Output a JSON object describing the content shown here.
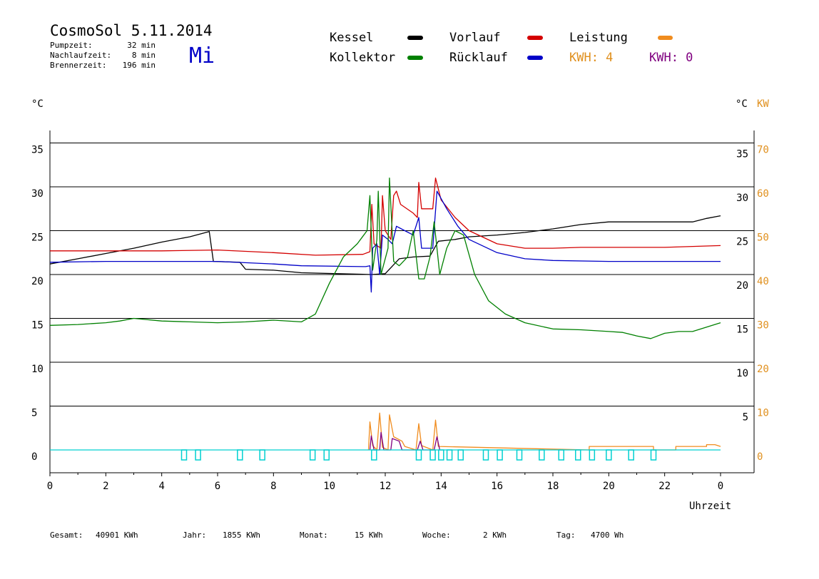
{
  "header": {
    "title": "CosmoSol 5.11.2014",
    "day": "Mi",
    "stats": [
      {
        "label": "Pumpzeit:",
        "value": "32 min"
      },
      {
        "label": "Nachlaufzeit:",
        "value": "8 min"
      },
      {
        "label": "Brennerzeit:",
        "value": "196 min"
      }
    ]
  },
  "legend": {
    "kessel": "Kessel",
    "kollektor": "Kollektor",
    "vorlauf": "Vorlauf",
    "ruecklauf": "Rücklauf",
    "leistung": "Leistung",
    "kwh1": "KWH: 4",
    "kwh2": "KWH: 0"
  },
  "axes": {
    "left_unit": "°C",
    "right_unit": "°C",
    "right_unit2": "KW",
    "xlabel": "Uhrzeit"
  },
  "footer": {
    "gesamt_label": "Gesamt:",
    "gesamt_value": "40901 KWh",
    "jahr_label": "Jahr:",
    "jahr_value": "1855 KWh",
    "monat_label": "Monat:",
    "monat_value": "15 KWh",
    "woche_label": "Woche:",
    "woche_value": "2 KWh",
    "tag_label": "Tag:",
    "tag_value": "4700 Wh"
  },
  "colors": {
    "kessel": "#000000",
    "kollektor": "#008000",
    "vorlauf": "#d40000",
    "ruecklauf": "#0000c8",
    "leistung": "#f08c1e",
    "kwh2": "#800080",
    "pump": "#00d0d0",
    "kwaxis": "#e0901e"
  },
  "chart_data": {
    "type": "line",
    "xlabel": "Uhrzeit",
    "x_ticks": [
      "0",
      "2",
      "4",
      "6",
      "8",
      "10",
      "12",
      "14",
      "16",
      "18",
      "20",
      "22",
      "0"
    ],
    "x_range": [
      0,
      24
    ],
    "y_left_ticks": [
      0,
      5,
      10,
      15,
      20,
      25,
      30,
      35
    ],
    "y_right_ticks": [
      5,
      10,
      15,
      20,
      25,
      30,
      35
    ],
    "y_kw_ticks": [
      0,
      10,
      20,
      30,
      40,
      50,
      60,
      70
    ],
    "ylim": [
      -2.5,
      38
    ],
    "grid": true,
    "series": [
      {
        "name": "Kessel",
        "key": "kessel",
        "points": [
          [
            0,
            21.2
          ],
          [
            1,
            21.8
          ],
          [
            2,
            22.4
          ],
          [
            3,
            23.0
          ],
          [
            4,
            23.7
          ],
          [
            5,
            24.3
          ],
          [
            5.7,
            24.9
          ],
          [
            5.85,
            21.5
          ],
          [
            6.8,
            21.4
          ],
          [
            7.0,
            20.6
          ],
          [
            8,
            20.5
          ],
          [
            9,
            20.2
          ],
          [
            11.5,
            20.0
          ],
          [
            12.0,
            20.1
          ],
          [
            12.5,
            21.8
          ],
          [
            13.0,
            22.0
          ],
          [
            13.6,
            22.1
          ],
          [
            13.9,
            23.8
          ],
          [
            14.5,
            24.0
          ],
          [
            15,
            24.3
          ],
          [
            16,
            24.5
          ],
          [
            17,
            24.8
          ],
          [
            18,
            25.2
          ],
          [
            19,
            25.7
          ],
          [
            20,
            26.0
          ],
          [
            21,
            26.0
          ],
          [
            22,
            26.0
          ],
          [
            23,
            26.0
          ],
          [
            23.5,
            26.4
          ],
          [
            24,
            26.7
          ]
        ]
      },
      {
        "name": "Vorlauf",
        "key": "vorlauf",
        "points": [
          [
            0,
            22.7
          ],
          [
            2,
            22.7
          ],
          [
            4,
            22.7
          ],
          [
            6,
            22.8
          ],
          [
            8,
            22.5
          ],
          [
            9.5,
            22.2
          ],
          [
            11.2,
            22.3
          ],
          [
            11.45,
            22.6
          ],
          [
            11.52,
            28.0
          ],
          [
            11.6,
            23.5
          ],
          [
            11.85,
            23.0
          ],
          [
            11.9,
            29.0
          ],
          [
            12.0,
            25.0
          ],
          [
            12.2,
            24.0
          ],
          [
            12.3,
            29.0
          ],
          [
            12.4,
            29.5
          ],
          [
            12.55,
            28.0
          ],
          [
            13.0,
            27.0
          ],
          [
            13.15,
            26.5
          ],
          [
            13.2,
            30.5
          ],
          [
            13.3,
            27.5
          ],
          [
            13.7,
            27.5
          ],
          [
            13.8,
            31.0
          ],
          [
            14.0,
            28.5
          ],
          [
            14.5,
            26.5
          ],
          [
            15,
            25.0
          ],
          [
            16,
            23.5
          ],
          [
            17,
            23.0
          ],
          [
            18,
            23.0
          ],
          [
            19,
            23.1
          ],
          [
            20,
            23.1
          ],
          [
            21,
            23.1
          ],
          [
            22,
            23.1
          ],
          [
            23,
            23.2
          ],
          [
            24,
            23.3
          ]
        ]
      },
      {
        "name": "Rücklauf",
        "key": "ruecklauf",
        "points": [
          [
            0,
            21.4
          ],
          [
            2,
            21.5
          ],
          [
            4,
            21.5
          ],
          [
            6,
            21.5
          ],
          [
            8,
            21.2
          ],
          [
            9,
            21.0
          ],
          [
            11.3,
            20.9
          ],
          [
            11.45,
            21.0
          ],
          [
            11.5,
            18.0
          ],
          [
            11.55,
            23.0
          ],
          [
            11.7,
            23.5
          ],
          [
            11.8,
            20.0
          ],
          [
            11.9,
            24.5
          ],
          [
            12.1,
            24.0
          ],
          [
            12.25,
            23.5
          ],
          [
            12.4,
            25.5
          ],
          [
            12.7,
            25.0
          ],
          [
            13.0,
            24.5
          ],
          [
            13.2,
            26.5
          ],
          [
            13.3,
            23.0
          ],
          [
            13.7,
            23.0
          ],
          [
            13.85,
            29.5
          ],
          [
            14.2,
            27.5
          ],
          [
            14.6,
            25.5
          ],
          [
            15,
            24.0
          ],
          [
            16,
            22.5
          ],
          [
            17,
            21.8
          ],
          [
            18,
            21.6
          ],
          [
            20,
            21.5
          ],
          [
            22,
            21.5
          ],
          [
            24,
            21.5
          ]
        ]
      },
      {
        "name": "Kollektor",
        "key": "kollektor",
        "points": [
          [
            0,
            14.2
          ],
          [
            1,
            14.3
          ],
          [
            2,
            14.5
          ],
          [
            2.5,
            14.7
          ],
          [
            3,
            15.0
          ],
          [
            4,
            14.7
          ],
          [
            5,
            14.6
          ],
          [
            6,
            14.5
          ],
          [
            7,
            14.6
          ],
          [
            8,
            14.8
          ],
          [
            9,
            14.6
          ],
          [
            9.5,
            15.5
          ],
          [
            10,
            19.0
          ],
          [
            10.5,
            22.0
          ],
          [
            11.0,
            23.5
          ],
          [
            11.35,
            25.0
          ],
          [
            11.45,
            29.0
          ],
          [
            11.55,
            20.5
          ],
          [
            11.7,
            24.0
          ],
          [
            11.75,
            29.5
          ],
          [
            11.85,
            20.0
          ],
          [
            12.1,
            23.0
          ],
          [
            12.15,
            31.0
          ],
          [
            12.3,
            21.5
          ],
          [
            12.5,
            21.0
          ],
          [
            12.8,
            22.0
          ],
          [
            13.0,
            25.0
          ],
          [
            13.2,
            19.5
          ],
          [
            13.4,
            19.5
          ],
          [
            13.6,
            22.0
          ],
          [
            13.75,
            26.0
          ],
          [
            13.85,
            23.0
          ],
          [
            13.95,
            20.0
          ],
          [
            14.2,
            23.0
          ],
          [
            14.5,
            25.0
          ],
          [
            14.8,
            24.5
          ],
          [
            15.2,
            20.0
          ],
          [
            15.7,
            17.0
          ],
          [
            16.3,
            15.5
          ],
          [
            17,
            14.5
          ],
          [
            18,
            13.8
          ],
          [
            19,
            13.7
          ],
          [
            20,
            13.5
          ],
          [
            20.5,
            13.4
          ],
          [
            21,
            13.0
          ],
          [
            21.5,
            12.7
          ],
          [
            22,
            13.3
          ],
          [
            22.5,
            13.5
          ],
          [
            23,
            13.5
          ],
          [
            23.5,
            14.0
          ],
          [
            24,
            14.5
          ]
        ]
      },
      {
        "name": "Leistung",
        "key": "leistung",
        "points": [
          [
            11.4,
            0
          ],
          [
            11.45,
            3.2
          ],
          [
            11.55,
            0.5
          ],
          [
            11.7,
            0
          ],
          [
            11.8,
            4.2
          ],
          [
            11.9,
            0.3
          ],
          [
            12.1,
            0
          ],
          [
            12.15,
            4.0
          ],
          [
            12.3,
            1.5
          ],
          [
            12.6,
            1.0
          ],
          [
            12.7,
            0.4
          ],
          [
            13.1,
            0
          ],
          [
            13.2,
            3.0
          ],
          [
            13.3,
            0.5
          ],
          [
            13.7,
            0
          ],
          [
            13.8,
            3.4
          ],
          [
            13.9,
            0.4
          ],
          [
            19.3,
            0
          ],
          [
            19.3,
            0.4
          ],
          [
            20.8,
            0.4
          ],
          [
            21.6,
            0.4
          ],
          [
            21.6,
            0
          ],
          [
            22.4,
            0
          ],
          [
            22.4,
            0.4
          ],
          [
            23.5,
            0.4
          ],
          [
            23.5,
            0.6
          ],
          [
            23.8,
            0.6
          ],
          [
            24,
            0.4
          ]
        ]
      },
      {
        "name": "KWH",
        "key": "kwh2",
        "points": [
          [
            11.45,
            0
          ],
          [
            11.5,
            1.6
          ],
          [
            11.6,
            0
          ],
          [
            11.8,
            0
          ],
          [
            11.85,
            2.0
          ],
          [
            11.95,
            0
          ],
          [
            12.2,
            0
          ],
          [
            12.25,
            1.3
          ],
          [
            12.5,
            1.0
          ],
          [
            12.6,
            0
          ],
          [
            13.15,
            0
          ],
          [
            13.25,
            1.0
          ],
          [
            13.35,
            0
          ],
          [
            13.75,
            0
          ],
          [
            13.85,
            1.5
          ],
          [
            13.95,
            0
          ]
        ]
      }
    ],
    "pump_markers": [
      4.8,
      5.3,
      6.8,
      7.6,
      9.4,
      9.9,
      11.6,
      13.2,
      13.7,
      14.0,
      14.3,
      14.7,
      15.6,
      16.1,
      16.8,
      17.6,
      18.3,
      18.9,
      19.4,
      20.0,
      20.8,
      21.6
    ]
  }
}
